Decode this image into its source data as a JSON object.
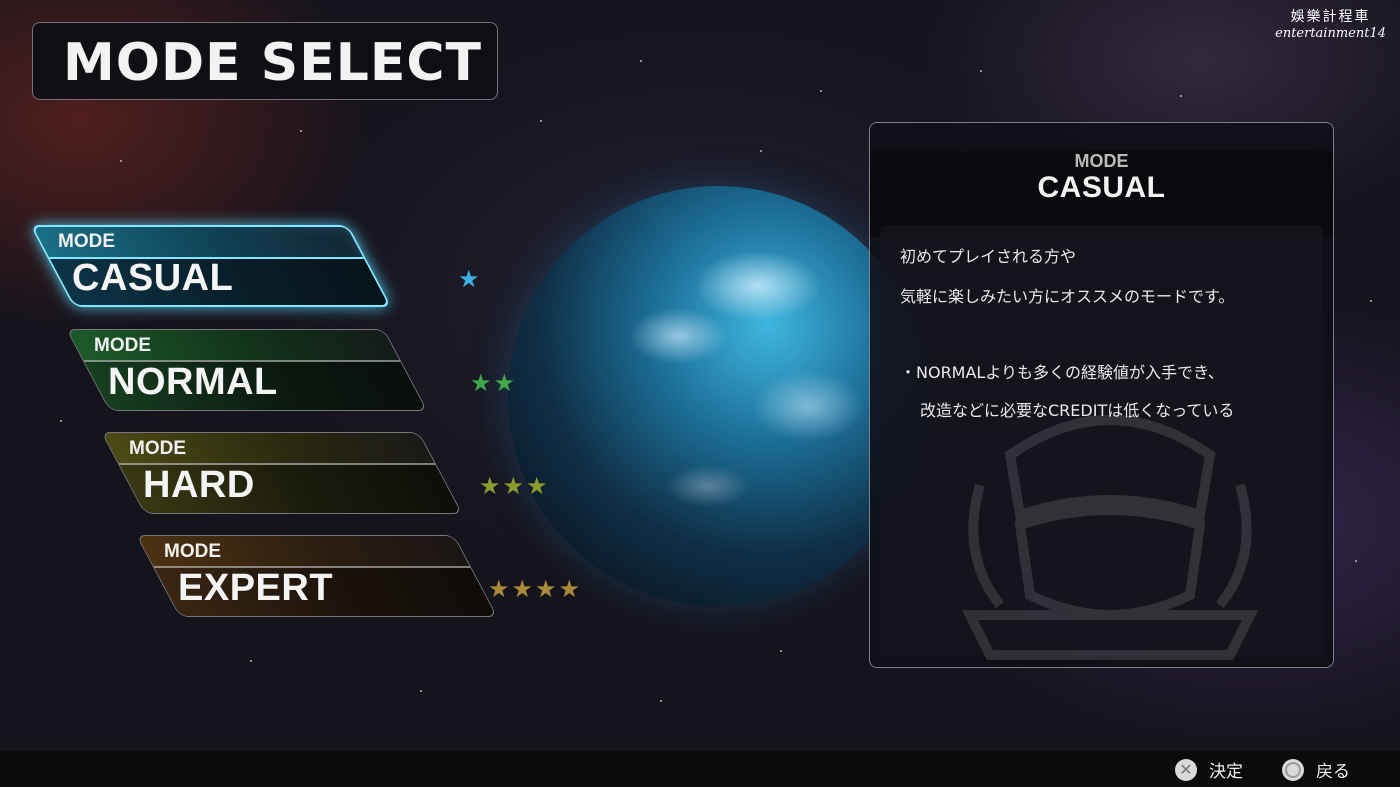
{
  "watermark": {
    "line1": "娛樂計程車",
    "line2": "entertainment14"
  },
  "header": {
    "title": "MODE SELECT"
  },
  "modes": [
    {
      "label": "MODE",
      "name": "CASUAL",
      "stars": "★",
      "star_color": "#3fb0e6",
      "selected": true
    },
    {
      "label": "MODE",
      "name": "NORMAL",
      "stars": "★★",
      "star_color": "#3fa64a",
      "selected": false
    },
    {
      "label": "MODE",
      "name": "HARD",
      "stars": "★★★",
      "star_color": "#8c9a2e",
      "selected": false
    },
    {
      "label": "MODE",
      "name": "EXPERT",
      "stars": "★★★★",
      "star_color": "#a98a3a",
      "selected": false
    }
  ],
  "info_panel": {
    "label": "MODE",
    "name": "CASUAL",
    "lines": [
      "初めてプレイされる方や",
      "気軽に楽しみたい方にオススメのモードです。",
      "・NORMALよりも多くの経験値が入手でき、",
      "改造などに必要なCREDITは低くなっている"
    ]
  },
  "footer": {
    "confirm": {
      "icon": "cross-button-icon",
      "symbol": "✕",
      "label": "決定"
    },
    "back": {
      "icon": "circle-button-icon",
      "label": "戻る"
    }
  }
}
